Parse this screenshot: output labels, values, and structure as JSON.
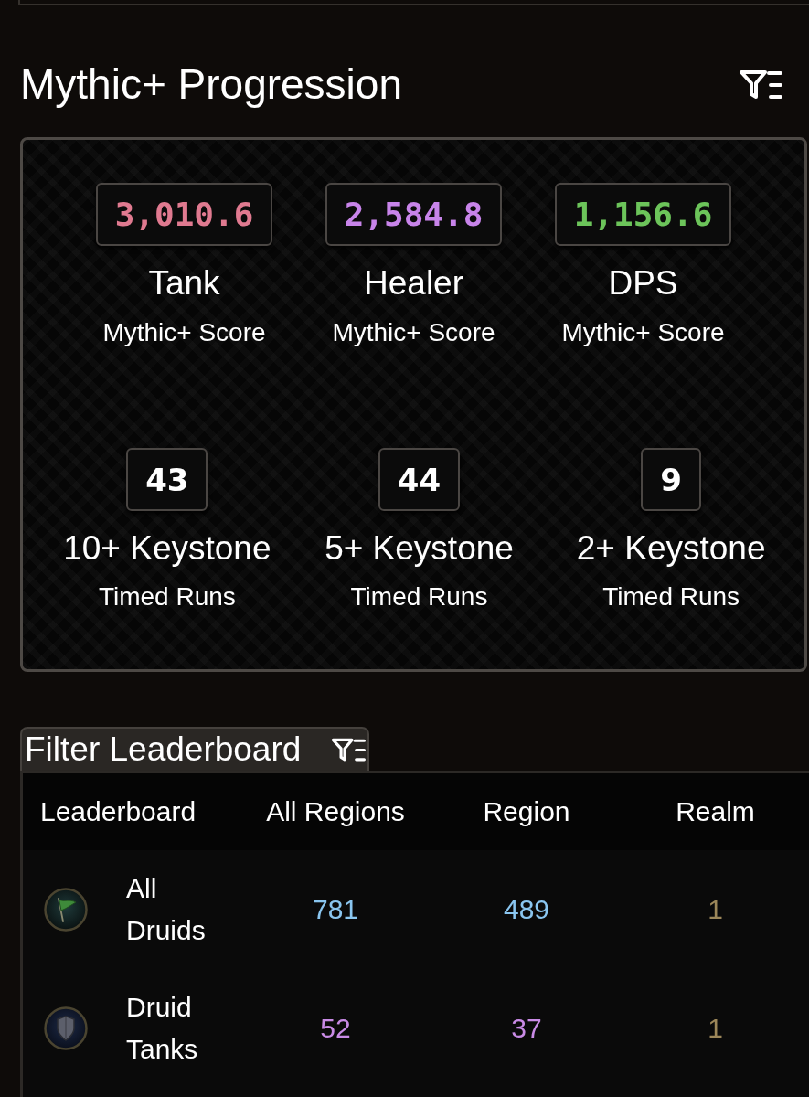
{
  "title": "Mythic+ Progression",
  "scores": [
    {
      "value": "3,010.6",
      "color": "#e07a90",
      "role": "Tank",
      "label": "Mythic+ Score"
    },
    {
      "value": "2,584.8",
      "color": "#c884ea",
      "role": "Healer",
      "label": "Mythic+ Score"
    },
    {
      "value": "1,156.6",
      "color": "#6cc45a",
      "role": "DPS",
      "label": "Mythic+ Score"
    }
  ],
  "timed_runs": [
    {
      "count": "43",
      "label": "10+ Keystone",
      "sublabel": "Timed Runs"
    },
    {
      "count": "44",
      "label": "5+ Keystone",
      "sublabel": "Timed Runs"
    },
    {
      "count": "9",
      "label": "2+ Keystone",
      "sublabel": "Timed Runs"
    }
  ],
  "leaderboard": {
    "filter_button": "Filter Leaderboard",
    "columns": [
      "Leaderboard",
      "All Regions",
      "Region",
      "Realm"
    ],
    "rows": [
      {
        "name": "All Druids",
        "kind": "class",
        "ranks": [
          {
            "value": "781",
            "color": "#8ac6f0"
          },
          {
            "value": "489",
            "color": "#8ac6f0"
          },
          {
            "value": "1",
            "color": "#9c8759"
          }
        ]
      },
      {
        "name": "Druid Tanks",
        "kind": "role",
        "ranks": [
          {
            "value": "52",
            "color": "#c98be6"
          },
          {
            "value": "37",
            "color": "#c98be6"
          },
          {
            "value": "1",
            "color": "#9c8759"
          }
        ]
      }
    ]
  }
}
